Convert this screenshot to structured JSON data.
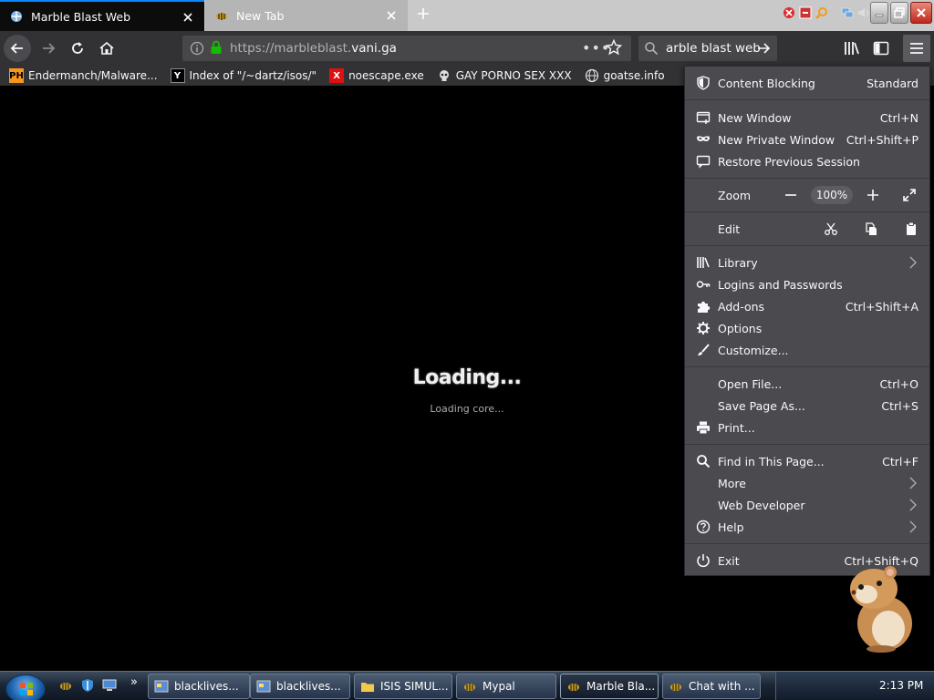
{
  "tabs": [
    {
      "title": "Marble Blast Web",
      "active": true,
      "icon": "marble-favicon"
    },
    {
      "title": "New Tab",
      "active": false,
      "icon": "bee-favicon"
    }
  ],
  "nav": {
    "url_prefix": "https://marbleblast.",
    "url_domain": "vani.ga",
    "search_text": "arble blast web"
  },
  "bookmarks": [
    {
      "label": "Endermanch/Malware...",
      "icon": "pornhub-icon"
    },
    {
      "label": "Index of \"/~dartz/isos/\"",
      "icon": "ycombinator-icon"
    },
    {
      "label": "noescape.exe",
      "icon": "x-icon"
    },
    {
      "label": "GAY PORNO SEX XXX",
      "icon": "skull-icon"
    },
    {
      "label": "goatse.info",
      "icon": "globe-icon"
    }
  ],
  "content": {
    "loading_title": "Loading...",
    "loading_sub": "Loading core..."
  },
  "menu": {
    "content_blocking": {
      "label": "Content Blocking",
      "value": "Standard"
    },
    "new_window": {
      "label": "New Window",
      "shortcut": "Ctrl+N"
    },
    "new_private": {
      "label": "New Private Window",
      "shortcut": "Ctrl+Shift+P"
    },
    "restore": {
      "label": "Restore Previous Session"
    },
    "zoom": {
      "label": "Zoom",
      "value": "100%"
    },
    "edit": {
      "label": "Edit"
    },
    "library": {
      "label": "Library"
    },
    "logins": {
      "label": "Logins and Passwords"
    },
    "addons": {
      "label": "Add-ons",
      "shortcut": "Ctrl+Shift+A"
    },
    "options": {
      "label": "Options"
    },
    "customize": {
      "label": "Customize..."
    },
    "open_file": {
      "label": "Open File...",
      "shortcut": "Ctrl+O"
    },
    "save_page": {
      "label": "Save Page As...",
      "shortcut": "Ctrl+S"
    },
    "print": {
      "label": "Print..."
    },
    "find": {
      "label": "Find in This Page...",
      "shortcut": "Ctrl+F"
    },
    "more": {
      "label": "More"
    },
    "web_dev": {
      "label": "Web Developer"
    },
    "help": {
      "label": "Help"
    },
    "exit": {
      "label": "Exit",
      "shortcut": "Ctrl+Shift+Q"
    }
  },
  "taskbar": {
    "overflow": "»",
    "buttons": [
      {
        "label": "blacklives...",
        "active": false
      },
      {
        "label": "blacklives...",
        "active": false
      },
      {
        "label": "ISIS SIMUL...",
        "active": false
      },
      {
        "label": "Mypal",
        "active": false
      },
      {
        "label": "Marble Bla...",
        "active": true
      },
      {
        "label": "Chat with ...",
        "active": false
      }
    ],
    "clock": "2:13 PM"
  },
  "colors": {
    "tab_accent": "#0a84ff",
    "toolbar": "#323234",
    "panel": "#4a4a4f",
    "lock_green": "#12bc00"
  }
}
